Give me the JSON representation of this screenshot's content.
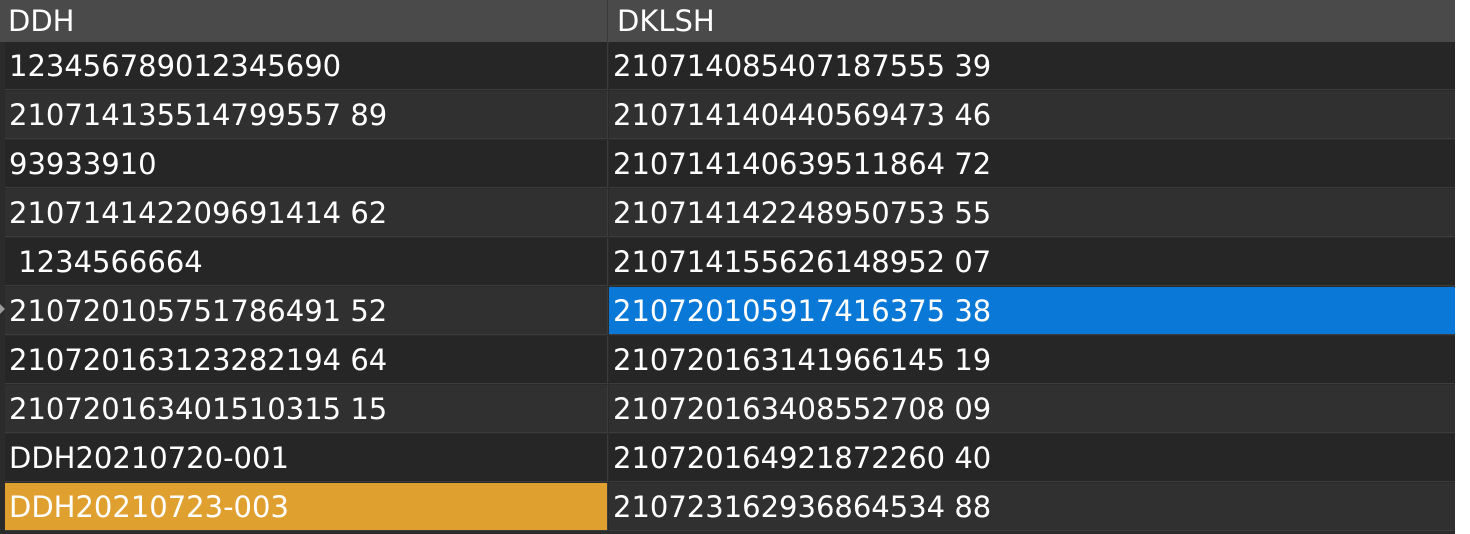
{
  "columns": {
    "ddh": "DDH",
    "dklsh": "DKLSH"
  },
  "rows": [
    {
      "ddh": "123456789012345690",
      "dklsh": "210714085407187555 39"
    },
    {
      "ddh": "210714135514799557 89",
      "dklsh": "210714140440569473 46"
    },
    {
      "ddh": "93933910",
      "dklsh": "210714140639511864 72"
    },
    {
      "ddh": "210714142209691414 62",
      "dklsh": "210714142248950753 55"
    },
    {
      "ddh": " 1234566664",
      "dklsh": "210714155626148952 07"
    },
    {
      "ddh": "210720105751786491 52",
      "dklsh": "210720105917416375 38"
    },
    {
      "ddh": "210720163123282194 64",
      "dklsh": "210720163141966145 19"
    },
    {
      "ddh": "210720163401510315 15",
      "dklsh": "210720163408552708 09"
    },
    {
      "ddh": "DDH20210720-001",
      "dklsh": "210720164921872260 40"
    },
    {
      "ddh": "DDH20210723-003",
      "dklsh": "210723162936864534 88"
    }
  ],
  "selection_colors": {
    "focused_cell": "#0a78d7",
    "highlighted_cell": "#e0a030"
  }
}
